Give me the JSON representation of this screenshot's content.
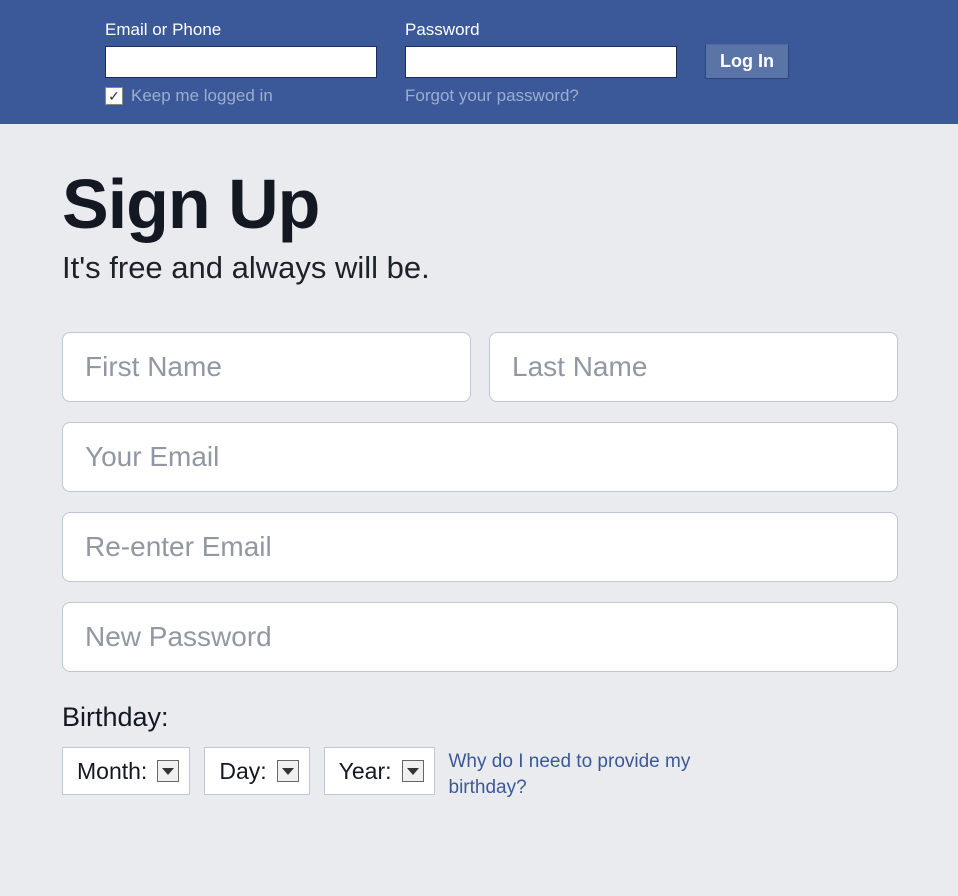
{
  "login": {
    "email_label": "Email or Phone",
    "password_label": "Password",
    "keep_logged_in": "Keep me logged in",
    "forgot_link": "Forgot your password?",
    "login_button": "Log In",
    "keep_checked_glyph": "✓"
  },
  "signup": {
    "title": "Sign Up",
    "subtitle": "It's free and always will be.",
    "first_name_placeholder": "First Name",
    "last_name_placeholder": "Last Name",
    "email_placeholder": "Your Email",
    "reemail_placeholder": "Re-enter Email",
    "password_placeholder": "New Password",
    "birthday_label": "Birthday:",
    "month_label": "Month:",
    "day_label": "Day:",
    "year_label": "Year:",
    "why_birthday": "Why do I need to provide my birthday?"
  }
}
